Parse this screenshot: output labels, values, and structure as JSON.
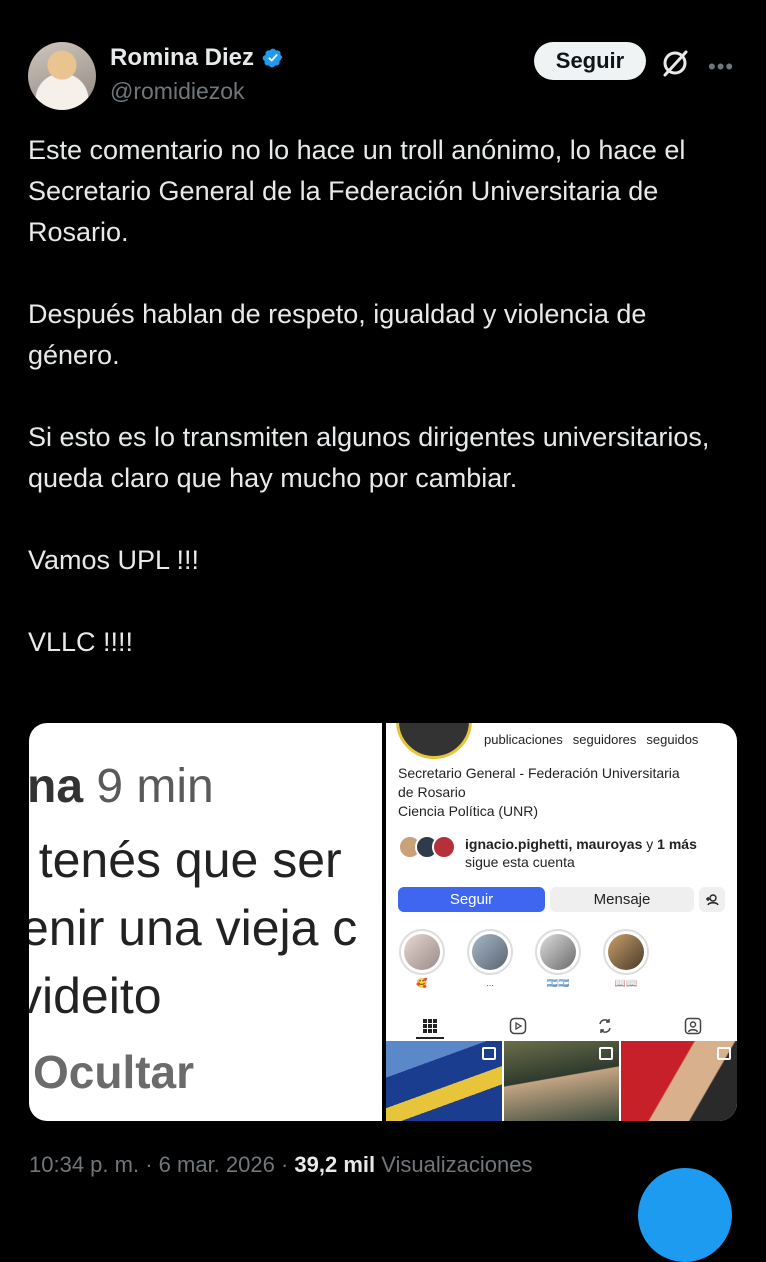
{
  "author": {
    "name": "Romina Diez",
    "handle": "@romidiezok",
    "verified": true,
    "verified_color": "#1d9bf0"
  },
  "actions": {
    "follow_label": "Seguir",
    "grok_icon": "grok-icon",
    "more_icon": "more-icon"
  },
  "tweet": {
    "text": "Este comentario no lo hace un troll anónimo, lo hace el Secretario General de la Federación Universitaria de Rosario.\n\nDespués hablan de respeto, igualdad y violencia de género.\n\nSi esto es lo transmiten algunos dirigentes universitarios, queda claro que hay mucho por cambiar.\n\nVamos UPL !!!\n\nVLLC !!!!"
  },
  "media": {
    "left": {
      "line1_name": "na",
      "line1_time": "9 min",
      "line2": "e tenés que ser",
      "line3": "enir una vieja c",
      "line4": "videito",
      "line5": "Ocultar"
    },
    "right": {
      "stats": [
        "publicaciones",
        "seguidores",
        "seguidos"
      ],
      "bio_line1": "Secretario General - Federación Universitaria",
      "bio_line2": "de Rosario",
      "bio_line3": "Ciencia Política (UNR)",
      "followed_by_names": "ignacio.pighetti, mauroyas",
      "followed_by_conj": "y",
      "followed_by_more": "1 más",
      "followed_by_suffix": "sigue esta cuenta",
      "follow_label": "Seguir",
      "message_label": "Mensaje",
      "highlights": [
        "🥰",
        "...",
        "🇦🇷🇦🇷",
        "📖📖"
      ],
      "follow_color": "#3f66f0"
    }
  },
  "meta": {
    "time": "10:34 p. m.",
    "sep1": "·",
    "date": "6 mar. 2026",
    "sep2": "·",
    "views_count": "39,2 mil",
    "views_label": "Visualizaciones"
  }
}
